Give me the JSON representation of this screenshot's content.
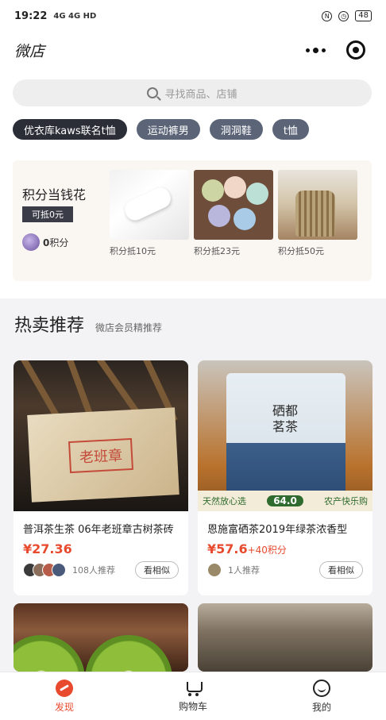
{
  "status": {
    "time": "19:22",
    "signal": "4G 4G HD",
    "battery": "48"
  },
  "header": {
    "title": "微店"
  },
  "search": {
    "placeholder": "寻找商品、店铺"
  },
  "chips": [
    "优衣库kaws联名t恤",
    "运动裤男",
    "洞洞鞋",
    "t恤"
  ],
  "points": {
    "title": "积分当钱花",
    "tag": "可抵0元",
    "count": "0",
    "count_unit": "积分",
    "rewards": [
      {
        "label": "积分抵10元"
      },
      {
        "label": "积分抵23元"
      },
      {
        "label": "积分抵50元"
      }
    ]
  },
  "section": {
    "title": "热卖推荐",
    "subtitle": "微店会员精推荐"
  },
  "products": [
    {
      "name": "普洱茶生茶 06年老班章古树茶砖",
      "price": "¥27.36",
      "price_extra": "",
      "recommend": "108人推荐",
      "similar": "看相似",
      "stamp": "老班章"
    },
    {
      "name": "恩施富硒茶2019年绿茶浓香型",
      "price": "¥57.6",
      "price_extra": "+40积分",
      "recommend": "1人推荐",
      "similar": "看相似",
      "bag_title": "硒都茗茶",
      "band_left": "天然放心选",
      "band_price": "64.0",
      "band_right": "农产快乐购"
    }
  ],
  "tabbar": [
    {
      "label": "发现",
      "icon": "discover-icon",
      "active": true
    },
    {
      "label": "购物车",
      "icon": "cart-icon",
      "active": false
    },
    {
      "label": "我的",
      "icon": "profile-icon",
      "active": false
    }
  ],
  "colors": {
    "accent": "#e84a2e",
    "chip_dark": "#2b2e37",
    "chip": "#5c6478"
  }
}
